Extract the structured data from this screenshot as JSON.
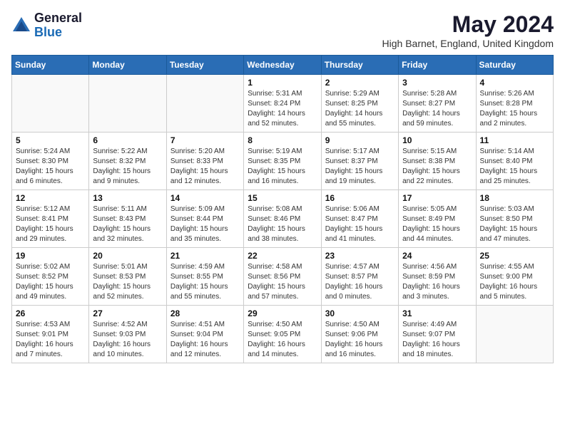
{
  "logo": {
    "general": "General",
    "blue": "Blue"
  },
  "title": "May 2024",
  "subtitle": "High Barnet, England, United Kingdom",
  "weekdays": [
    "Sunday",
    "Monday",
    "Tuesday",
    "Wednesday",
    "Thursday",
    "Friday",
    "Saturday"
  ],
  "weeks": [
    [
      {
        "day": "",
        "sunrise": "",
        "sunset": "",
        "daylight": ""
      },
      {
        "day": "",
        "sunrise": "",
        "sunset": "",
        "daylight": ""
      },
      {
        "day": "",
        "sunrise": "",
        "sunset": "",
        "daylight": ""
      },
      {
        "day": "1",
        "sunrise": "Sunrise: 5:31 AM",
        "sunset": "Sunset: 8:24 PM",
        "daylight": "Daylight: 14 hours and 52 minutes."
      },
      {
        "day": "2",
        "sunrise": "Sunrise: 5:29 AM",
        "sunset": "Sunset: 8:25 PM",
        "daylight": "Daylight: 14 hours and 55 minutes."
      },
      {
        "day": "3",
        "sunrise": "Sunrise: 5:28 AM",
        "sunset": "Sunset: 8:27 PM",
        "daylight": "Daylight: 14 hours and 59 minutes."
      },
      {
        "day": "4",
        "sunrise": "Sunrise: 5:26 AM",
        "sunset": "Sunset: 8:28 PM",
        "daylight": "Daylight: 15 hours and 2 minutes."
      }
    ],
    [
      {
        "day": "5",
        "sunrise": "Sunrise: 5:24 AM",
        "sunset": "Sunset: 8:30 PM",
        "daylight": "Daylight: 15 hours and 6 minutes."
      },
      {
        "day": "6",
        "sunrise": "Sunrise: 5:22 AM",
        "sunset": "Sunset: 8:32 PM",
        "daylight": "Daylight: 15 hours and 9 minutes."
      },
      {
        "day": "7",
        "sunrise": "Sunrise: 5:20 AM",
        "sunset": "Sunset: 8:33 PM",
        "daylight": "Daylight: 15 hours and 12 minutes."
      },
      {
        "day": "8",
        "sunrise": "Sunrise: 5:19 AM",
        "sunset": "Sunset: 8:35 PM",
        "daylight": "Daylight: 15 hours and 16 minutes."
      },
      {
        "day": "9",
        "sunrise": "Sunrise: 5:17 AM",
        "sunset": "Sunset: 8:37 PM",
        "daylight": "Daylight: 15 hours and 19 minutes."
      },
      {
        "day": "10",
        "sunrise": "Sunrise: 5:15 AM",
        "sunset": "Sunset: 8:38 PM",
        "daylight": "Daylight: 15 hours and 22 minutes."
      },
      {
        "day": "11",
        "sunrise": "Sunrise: 5:14 AM",
        "sunset": "Sunset: 8:40 PM",
        "daylight": "Daylight: 15 hours and 25 minutes."
      }
    ],
    [
      {
        "day": "12",
        "sunrise": "Sunrise: 5:12 AM",
        "sunset": "Sunset: 8:41 PM",
        "daylight": "Daylight: 15 hours and 29 minutes."
      },
      {
        "day": "13",
        "sunrise": "Sunrise: 5:11 AM",
        "sunset": "Sunset: 8:43 PM",
        "daylight": "Daylight: 15 hours and 32 minutes."
      },
      {
        "day": "14",
        "sunrise": "Sunrise: 5:09 AM",
        "sunset": "Sunset: 8:44 PM",
        "daylight": "Daylight: 15 hours and 35 minutes."
      },
      {
        "day": "15",
        "sunrise": "Sunrise: 5:08 AM",
        "sunset": "Sunset: 8:46 PM",
        "daylight": "Daylight: 15 hours and 38 minutes."
      },
      {
        "day": "16",
        "sunrise": "Sunrise: 5:06 AM",
        "sunset": "Sunset: 8:47 PM",
        "daylight": "Daylight: 15 hours and 41 minutes."
      },
      {
        "day": "17",
        "sunrise": "Sunrise: 5:05 AM",
        "sunset": "Sunset: 8:49 PM",
        "daylight": "Daylight: 15 hours and 44 minutes."
      },
      {
        "day": "18",
        "sunrise": "Sunrise: 5:03 AM",
        "sunset": "Sunset: 8:50 PM",
        "daylight": "Daylight: 15 hours and 47 minutes."
      }
    ],
    [
      {
        "day": "19",
        "sunrise": "Sunrise: 5:02 AM",
        "sunset": "Sunset: 8:52 PM",
        "daylight": "Daylight: 15 hours and 49 minutes."
      },
      {
        "day": "20",
        "sunrise": "Sunrise: 5:01 AM",
        "sunset": "Sunset: 8:53 PM",
        "daylight": "Daylight: 15 hours and 52 minutes."
      },
      {
        "day": "21",
        "sunrise": "Sunrise: 4:59 AM",
        "sunset": "Sunset: 8:55 PM",
        "daylight": "Daylight: 15 hours and 55 minutes."
      },
      {
        "day": "22",
        "sunrise": "Sunrise: 4:58 AM",
        "sunset": "Sunset: 8:56 PM",
        "daylight": "Daylight: 15 hours and 57 minutes."
      },
      {
        "day": "23",
        "sunrise": "Sunrise: 4:57 AM",
        "sunset": "Sunset: 8:57 PM",
        "daylight": "Daylight: 16 hours and 0 minutes."
      },
      {
        "day": "24",
        "sunrise": "Sunrise: 4:56 AM",
        "sunset": "Sunset: 8:59 PM",
        "daylight": "Daylight: 16 hours and 3 minutes."
      },
      {
        "day": "25",
        "sunrise": "Sunrise: 4:55 AM",
        "sunset": "Sunset: 9:00 PM",
        "daylight": "Daylight: 16 hours and 5 minutes."
      }
    ],
    [
      {
        "day": "26",
        "sunrise": "Sunrise: 4:53 AM",
        "sunset": "Sunset: 9:01 PM",
        "daylight": "Daylight: 16 hours and 7 minutes."
      },
      {
        "day": "27",
        "sunrise": "Sunrise: 4:52 AM",
        "sunset": "Sunset: 9:03 PM",
        "daylight": "Daylight: 16 hours and 10 minutes."
      },
      {
        "day": "28",
        "sunrise": "Sunrise: 4:51 AM",
        "sunset": "Sunset: 9:04 PM",
        "daylight": "Daylight: 16 hours and 12 minutes."
      },
      {
        "day": "29",
        "sunrise": "Sunrise: 4:50 AM",
        "sunset": "Sunset: 9:05 PM",
        "daylight": "Daylight: 16 hours and 14 minutes."
      },
      {
        "day": "30",
        "sunrise": "Sunrise: 4:50 AM",
        "sunset": "Sunset: 9:06 PM",
        "daylight": "Daylight: 16 hours and 16 minutes."
      },
      {
        "day": "31",
        "sunrise": "Sunrise: 4:49 AM",
        "sunset": "Sunset: 9:07 PM",
        "daylight": "Daylight: 16 hours and 18 minutes."
      },
      {
        "day": "",
        "sunrise": "",
        "sunset": "",
        "daylight": ""
      }
    ]
  ]
}
